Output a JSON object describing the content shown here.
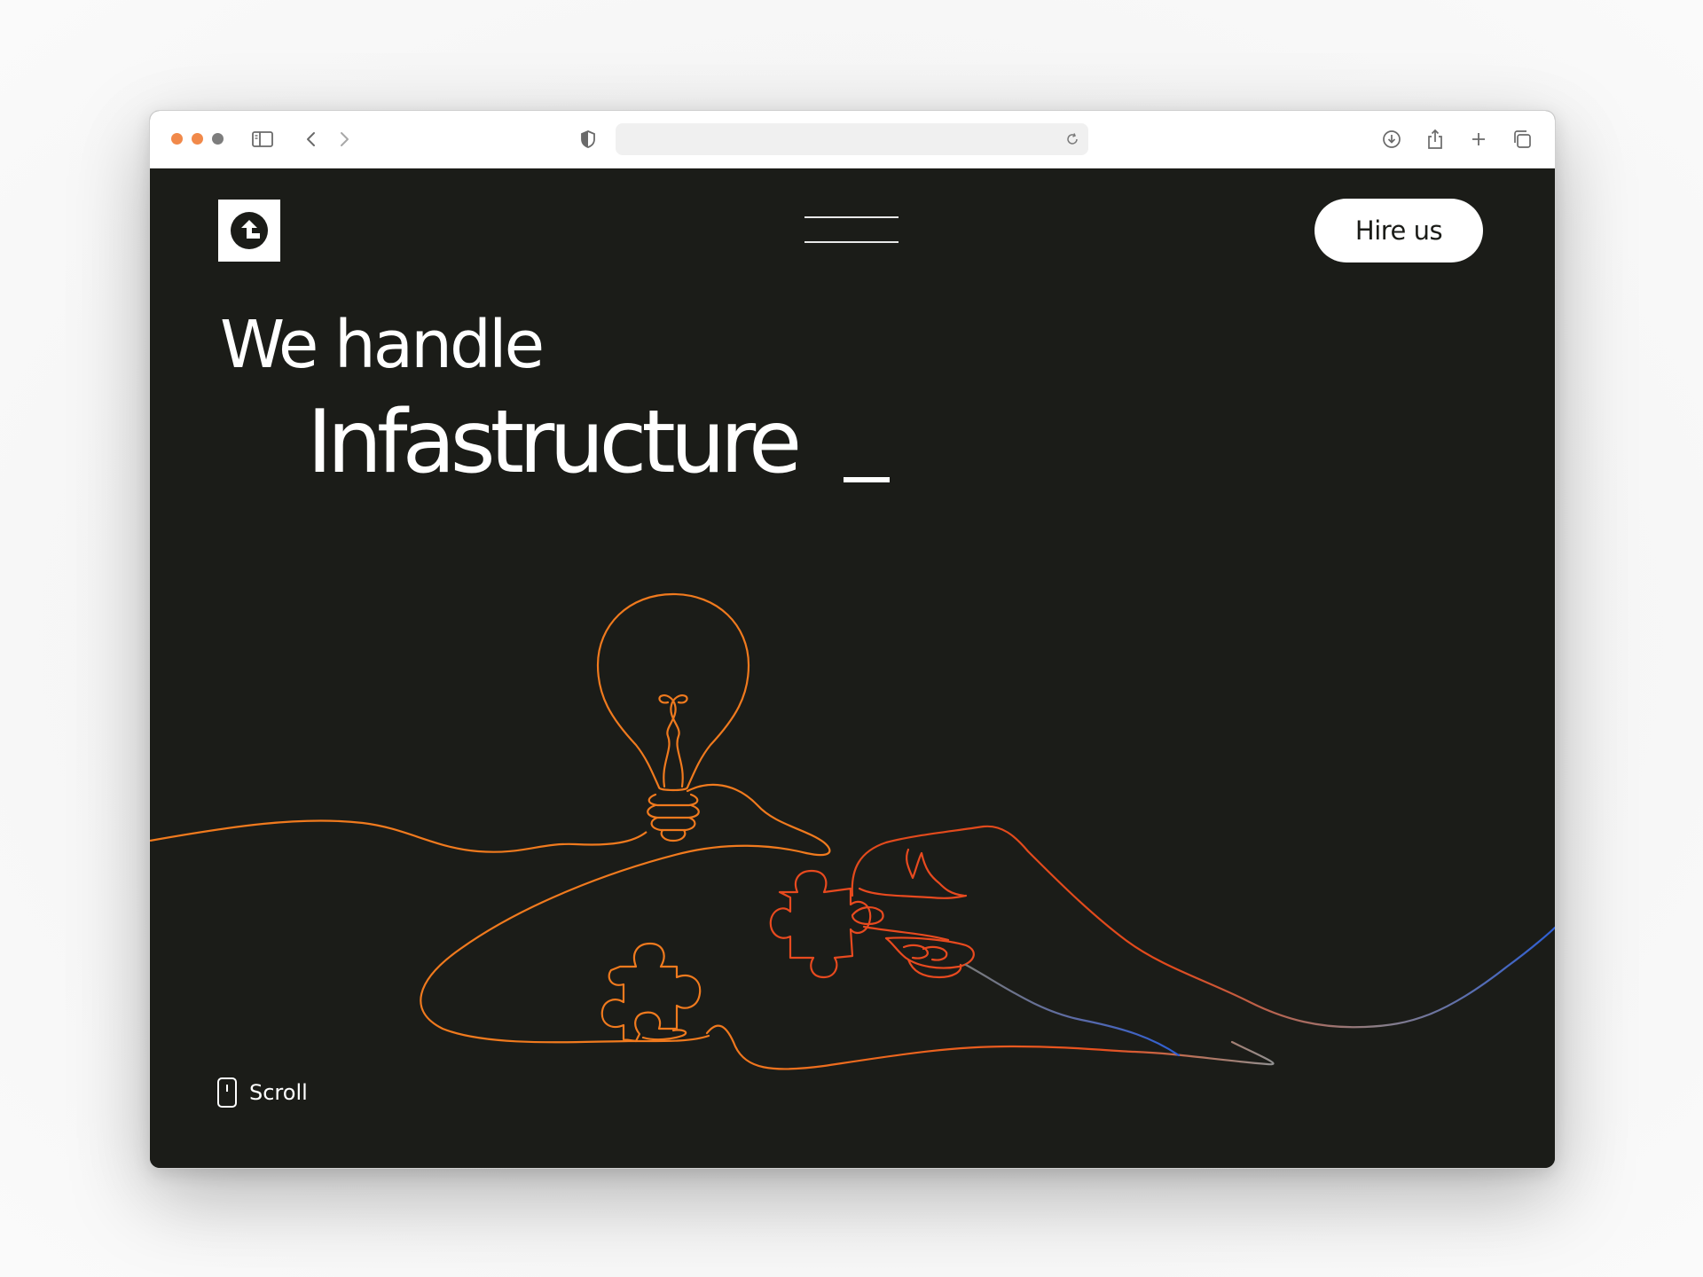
{
  "browser": {
    "traffic_lights": [
      "#f1894a",
      "#f1894a",
      "#7d7d7d"
    ],
    "address_text": ""
  },
  "header": {
    "logo_icon": "arrow-up-circle-logo",
    "menu_icon": "hamburger-icon",
    "hire_label": "Hire us"
  },
  "hero": {
    "line1": "We handle",
    "line2": "Infastructure"
  },
  "scroll": {
    "label": "Scroll",
    "icon": "mouse-icon"
  },
  "colors": {
    "background": "#1b1c18",
    "accent_orange": "#f07a1e",
    "accent_red": "#e84a1f",
    "accent_blue": "#2d5fd6",
    "text": "#ffffff"
  }
}
